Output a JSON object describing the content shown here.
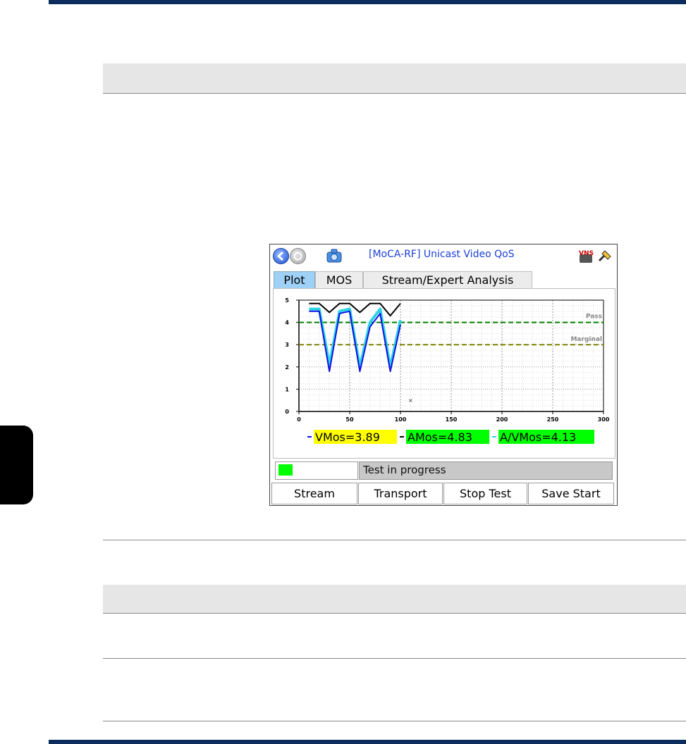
{
  "window": {
    "title": "[MoCA-RF] Unicast Video QoS",
    "vns_badge": "VNS"
  },
  "tabs": [
    {
      "label": "Plot",
      "active": true
    },
    {
      "label": "MOS",
      "active": false
    },
    {
      "label": "Stream/Expert Analysis",
      "active": false
    }
  ],
  "legend": {
    "vmos": "VMos=3.89",
    "amos": "AMos=4.83",
    "avmos": "A/VMos=4.13"
  },
  "thresholds": {
    "pass": "Pass",
    "marginal": "Marginal"
  },
  "status": {
    "text": "Test in progress",
    "indicator_color": "#00ff00"
  },
  "buttons": {
    "stream": "Stream",
    "transport": "Transport",
    "stop_test": "Stop Test",
    "save_start": "Save Start"
  },
  "colors": {
    "vmos_highlight": "#ffff00",
    "amos_highlight": "#00ff00",
    "avmos_highlight": "#00ff00",
    "pass_line": "#008000",
    "marginal_line": "#808000"
  },
  "chart_data": {
    "type": "line",
    "xlim": [
      0,
      300
    ],
    "ylim": [
      0,
      5
    ],
    "x_ticks": [
      "0",
      "50",
      "100",
      "150",
      "200",
      "250",
      "300"
    ],
    "y_ticks": [
      "0",
      "1",
      "2",
      "3",
      "4",
      "5"
    ],
    "pass_level": 4,
    "marginal_level": 3,
    "grid": true,
    "series": [
      {
        "key": "amos",
        "color": "#000000",
        "x": [
          10,
          20,
          30,
          40,
          50,
          60,
          70,
          80,
          90,
          100
        ],
        "y": [
          4.85,
          4.85,
          4.45,
          4.85,
          4.85,
          4.45,
          4.85,
          4.85,
          4.3,
          4.85
        ]
      },
      {
        "key": "avmos",
        "color": "#2ad4e6",
        "x": [
          10,
          20,
          30,
          40,
          50,
          60,
          70,
          80,
          90,
          100
        ],
        "y": [
          4.6,
          4.6,
          2.1,
          4.5,
          4.6,
          2.0,
          4.0,
          4.6,
          2.0,
          4.1
        ]
      },
      {
        "key": "vmos",
        "color": "#1010e0",
        "x": [
          10,
          20,
          30,
          40,
          50,
          60,
          70,
          80,
          90,
          100
        ],
        "y": [
          4.5,
          4.5,
          1.8,
          4.4,
          4.5,
          1.8,
          3.8,
          4.4,
          1.8,
          3.9
        ]
      }
    ],
    "marker": {
      "x": 110,
      "y": 0.5
    }
  }
}
